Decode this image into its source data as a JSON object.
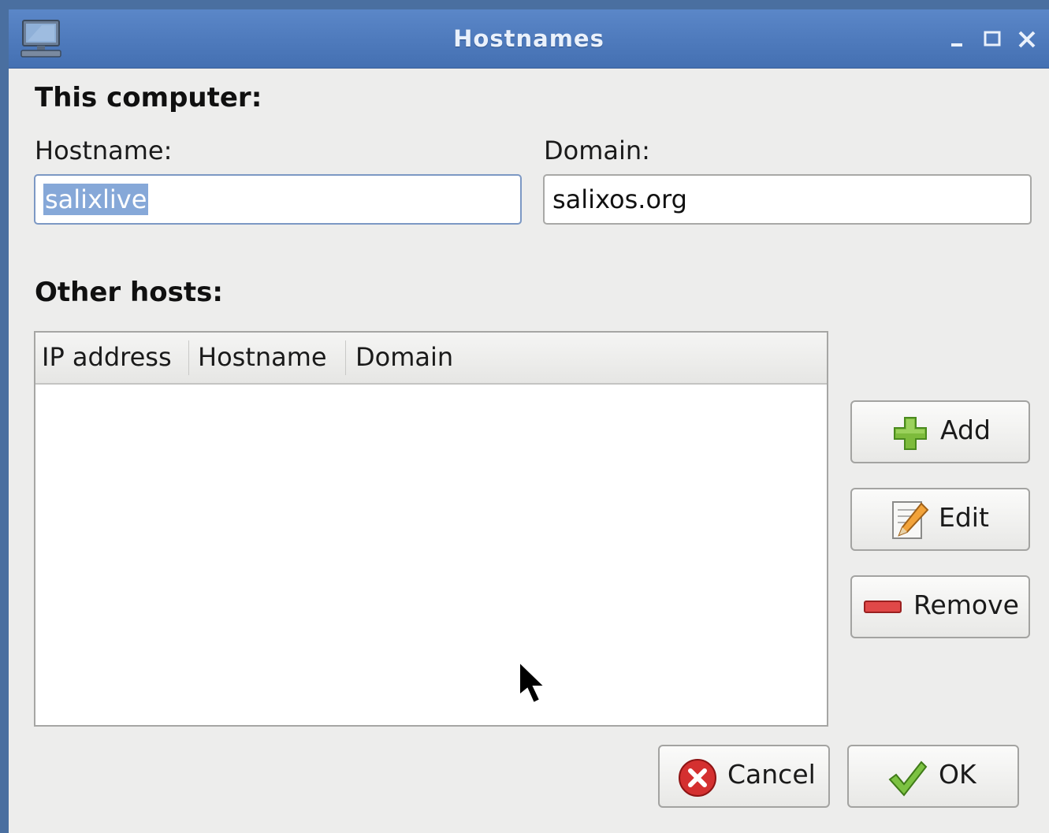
{
  "window": {
    "title": "Hostnames"
  },
  "icons": {
    "app": "computer-icon",
    "minimize": "minimize-icon",
    "maximize": "maximize-icon",
    "close": "close-icon",
    "add": "plus-icon",
    "edit": "pencil-icon",
    "remove": "minus-icon",
    "cancel": "cancel-icon",
    "ok": "checkmark-icon"
  },
  "this_computer": {
    "heading": "This computer:",
    "hostname_label": "Hostname:",
    "hostname_value": "salixlive",
    "domain_label": "Domain:",
    "domain_value": "salixos.org"
  },
  "other_hosts": {
    "heading": "Other hosts:",
    "columns": [
      "IP address",
      "Hostname",
      "Domain"
    ],
    "rows": []
  },
  "buttons": {
    "add": "Add",
    "edit": "Edit",
    "remove": "Remove",
    "cancel": "Cancel",
    "ok": "OK"
  },
  "colors": {
    "titlebar": "#4f7bbd",
    "selection": "#86a8d8",
    "background": "#ededec"
  }
}
